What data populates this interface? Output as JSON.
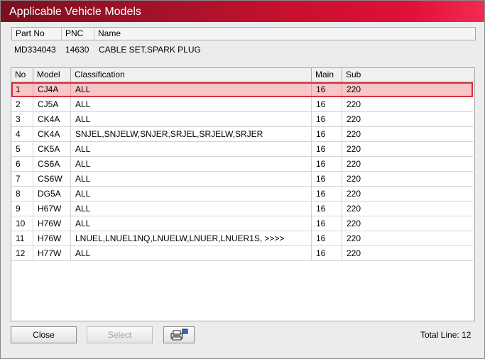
{
  "window": {
    "title": "Applicable Vehicle Models"
  },
  "part": {
    "headers": [
      "Part No",
      "PNC",
      "Name"
    ],
    "values": {
      "part_no": "MD334043",
      "pnc": "14630",
      "name": "CABLE SET,SPARK PLUG"
    }
  },
  "grid": {
    "columns": [
      "No",
      "Model",
      "Classification",
      "Main",
      "Sub"
    ],
    "rows": [
      {
        "no": "1",
        "model": "CJ4A",
        "classification": "ALL",
        "main": "16",
        "sub": "220",
        "selected": true
      },
      {
        "no": "2",
        "model": "CJ5A",
        "classification": "ALL",
        "main": "16",
        "sub": "220"
      },
      {
        "no": "3",
        "model": "CK4A",
        "classification": "ALL",
        "main": "16",
        "sub": "220"
      },
      {
        "no": "4",
        "model": "CK4A",
        "classification": "SNJEL,SNJELW,SNJER,SRJEL,SRJELW,SRJER",
        "main": "16",
        "sub": "220"
      },
      {
        "no": "5",
        "model": "CK5A",
        "classification": "ALL",
        "main": "16",
        "sub": "220"
      },
      {
        "no": "6",
        "model": "CS6A",
        "classification": "ALL",
        "main": "16",
        "sub": "220"
      },
      {
        "no": "7",
        "model": "CS6W",
        "classification": "ALL",
        "main": "16",
        "sub": "220"
      },
      {
        "no": "8",
        "model": "DG5A",
        "classification": "ALL",
        "main": "16",
        "sub": "220"
      },
      {
        "no": "9",
        "model": "H67W",
        "classification": "ALL",
        "main": "16",
        "sub": "220"
      },
      {
        "no": "10",
        "model": "H76W",
        "classification": "ALL",
        "main": "16",
        "sub": "220"
      },
      {
        "no": "11",
        "model": "H76W",
        "classification": "LNUEL,LNUEL1NQ,LNUELW,LNUER,LNUER1S,  >>>>",
        "main": "16",
        "sub": "220"
      },
      {
        "no": "12",
        "model": "H77W",
        "classification": "ALL",
        "main": "16",
        "sub": "220"
      }
    ]
  },
  "footer": {
    "close_label": "Close",
    "select_label": "Select",
    "print_icon": "printer-icon",
    "total_line": "Total Line: 12"
  },
  "colors": {
    "title_gradient_end": "#f42a52",
    "selected_row_bg": "#f9c5c7",
    "selected_row_border": "#d9303e"
  }
}
